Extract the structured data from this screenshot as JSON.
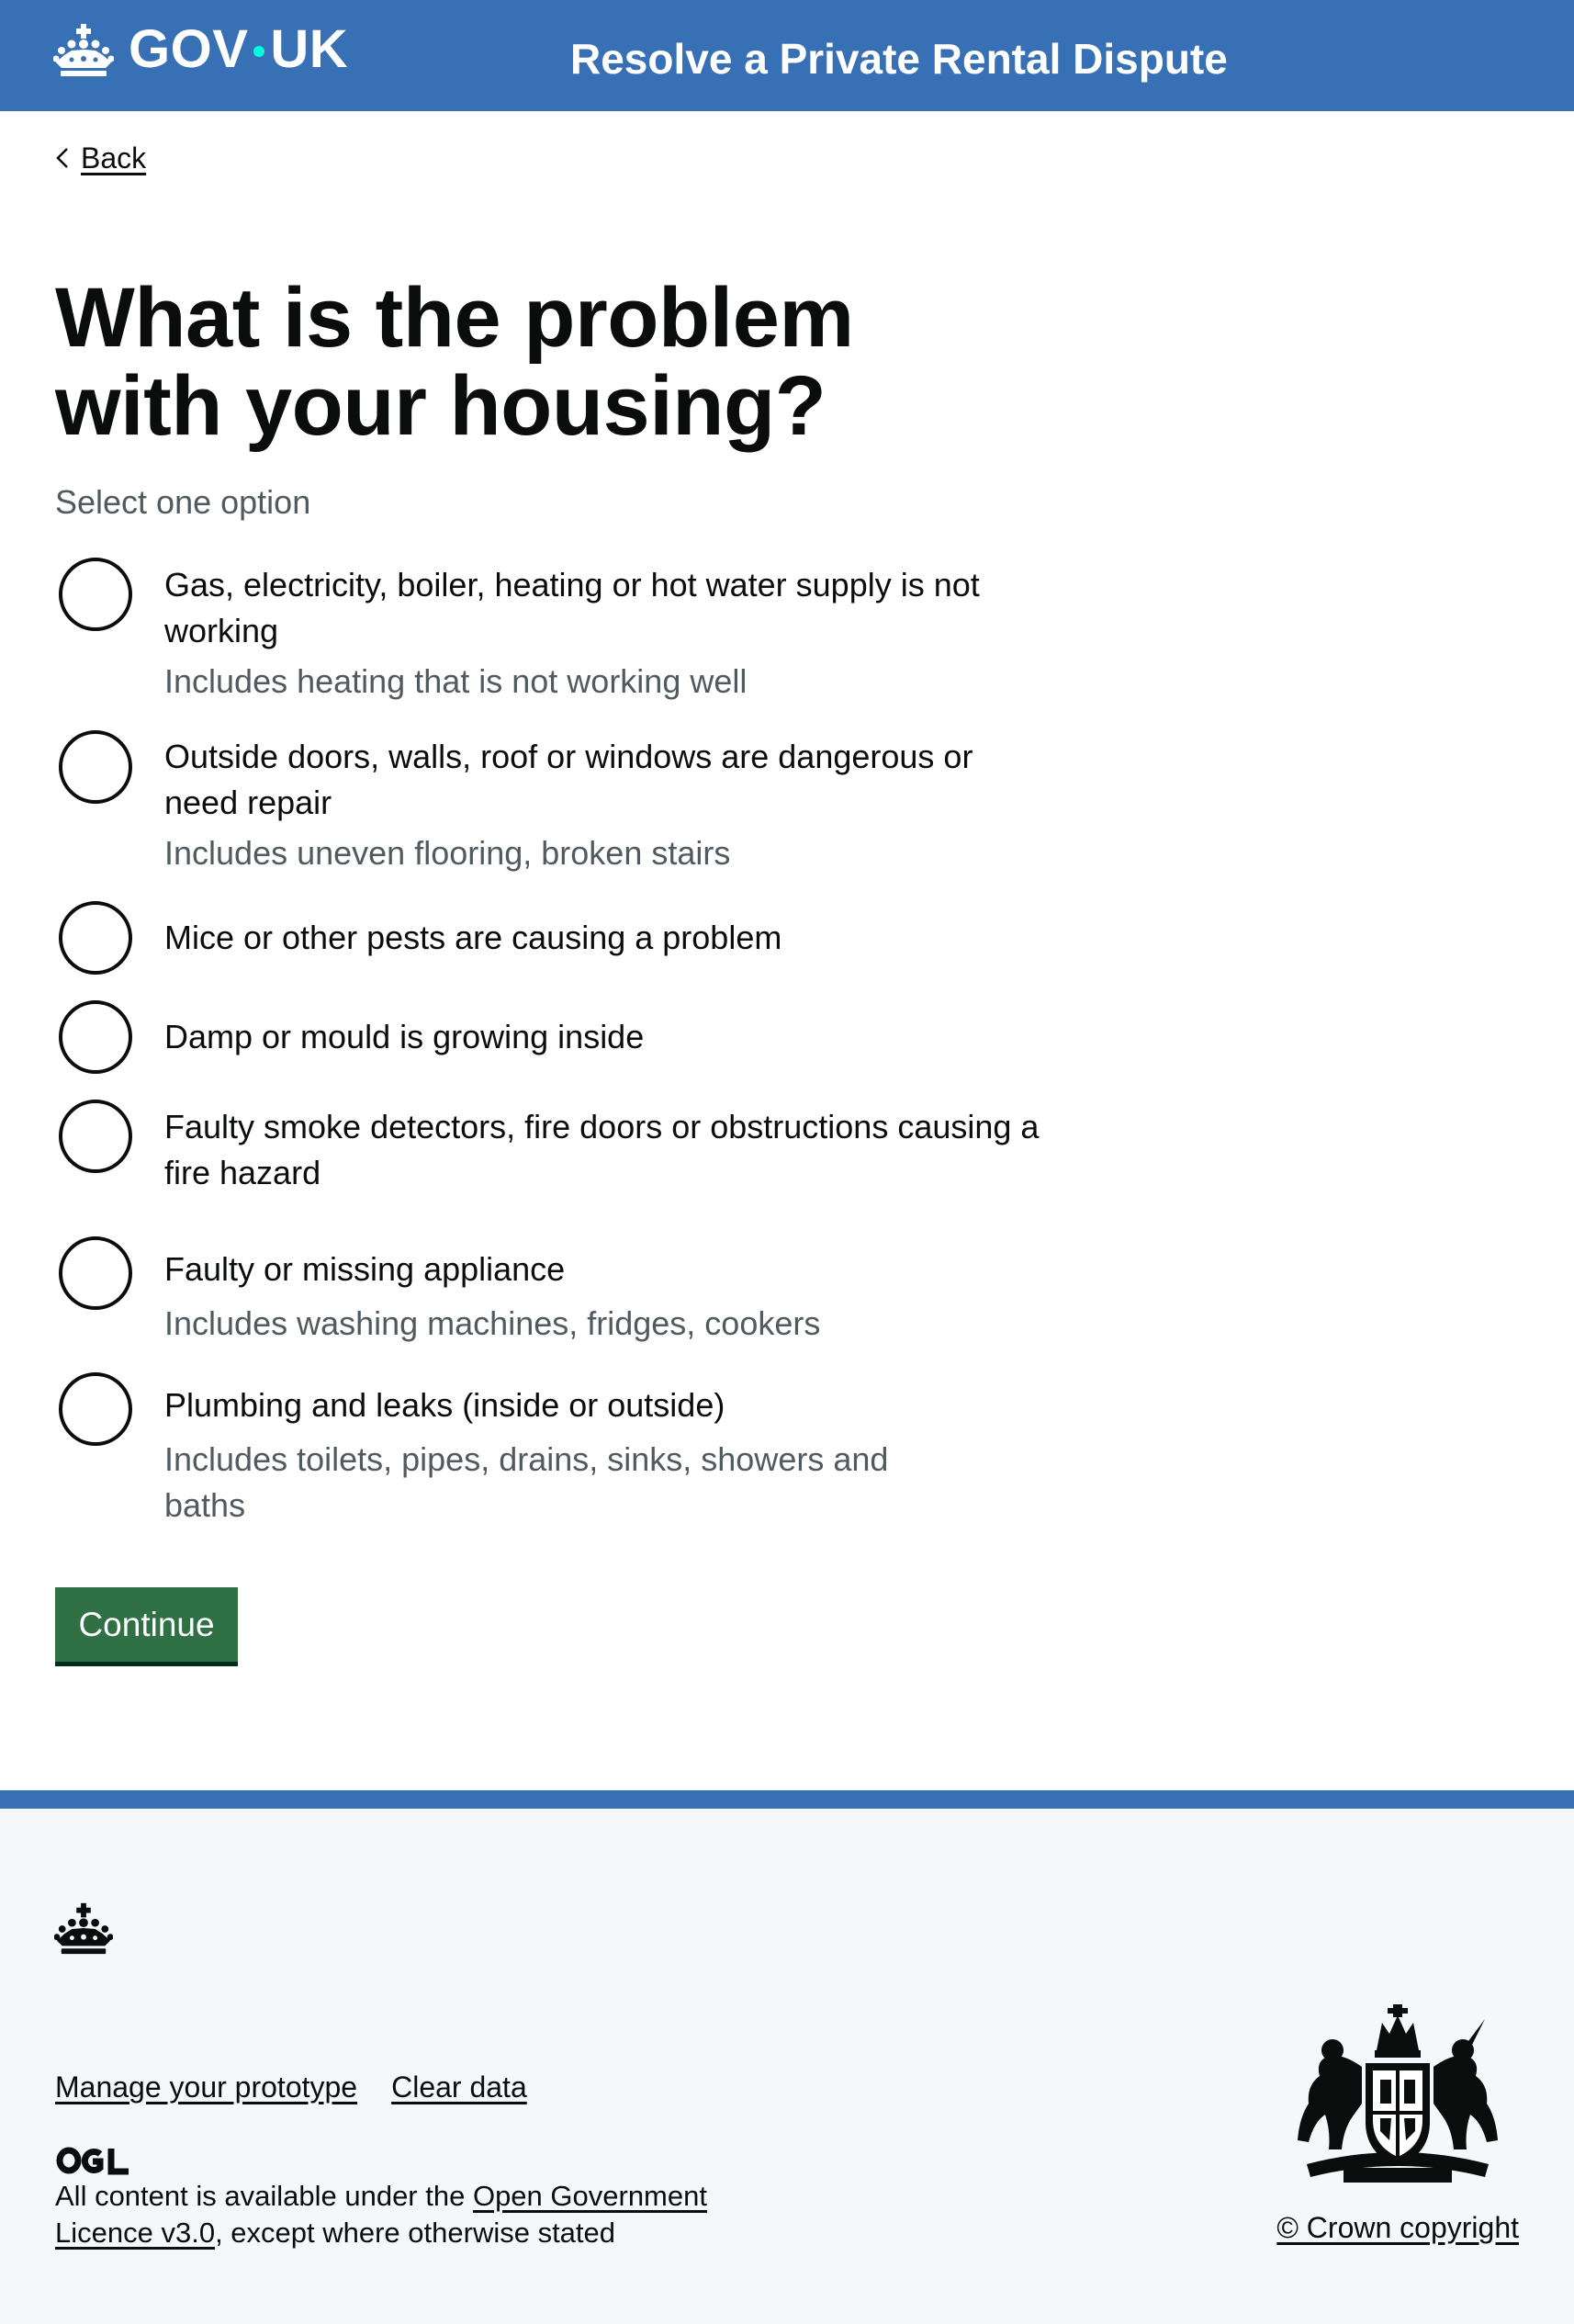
{
  "header": {
    "logo_left": "GOV",
    "logo_right": "UK",
    "service_name": "Resolve a Private Rental Dispute"
  },
  "back": {
    "label": "Back"
  },
  "question": {
    "heading": "What is the problem with your housing?",
    "hint": "Select one option"
  },
  "options": [
    {
      "label": "Gas, electricity, boiler, heating or hot water supply is not working",
      "hint": "Includes heating that is not working well"
    },
    {
      "label": "Outside doors, walls, roof or windows are dangerous or need repair",
      "hint": "Includes uneven flooring, broken stairs"
    },
    {
      "label": "Mice or other pests are causing a problem",
      "hint": ""
    },
    {
      "label": "Damp or mould is growing inside",
      "hint": ""
    },
    {
      "label": "Faulty smoke detectors, fire doors or obstructions causing a fire hazard",
      "hint": ""
    },
    {
      "label": "Faulty or missing appliance",
      "hint": "Includes washing machines, fridges, cookers"
    },
    {
      "label": "Plumbing and leaks (inside or outside)",
      "hint": "Includes toilets, pipes, drains, sinks, showers and baths"
    }
  ],
  "continue_label": "Continue",
  "footer": {
    "links": [
      "Manage your prototype",
      "Clear data"
    ],
    "licence_prefix": "All content is available under the ",
    "licence_link": "Open Government Licence v3.0",
    "licence_suffix": ", except where otherwise stated",
    "copyright": "© Crown copyright"
  },
  "colors": {
    "header_bg": "#3770b4",
    "button_green": "#2f7145",
    "hint_grey": "#505a5f",
    "footer_bg": "#f4f8fb"
  }
}
